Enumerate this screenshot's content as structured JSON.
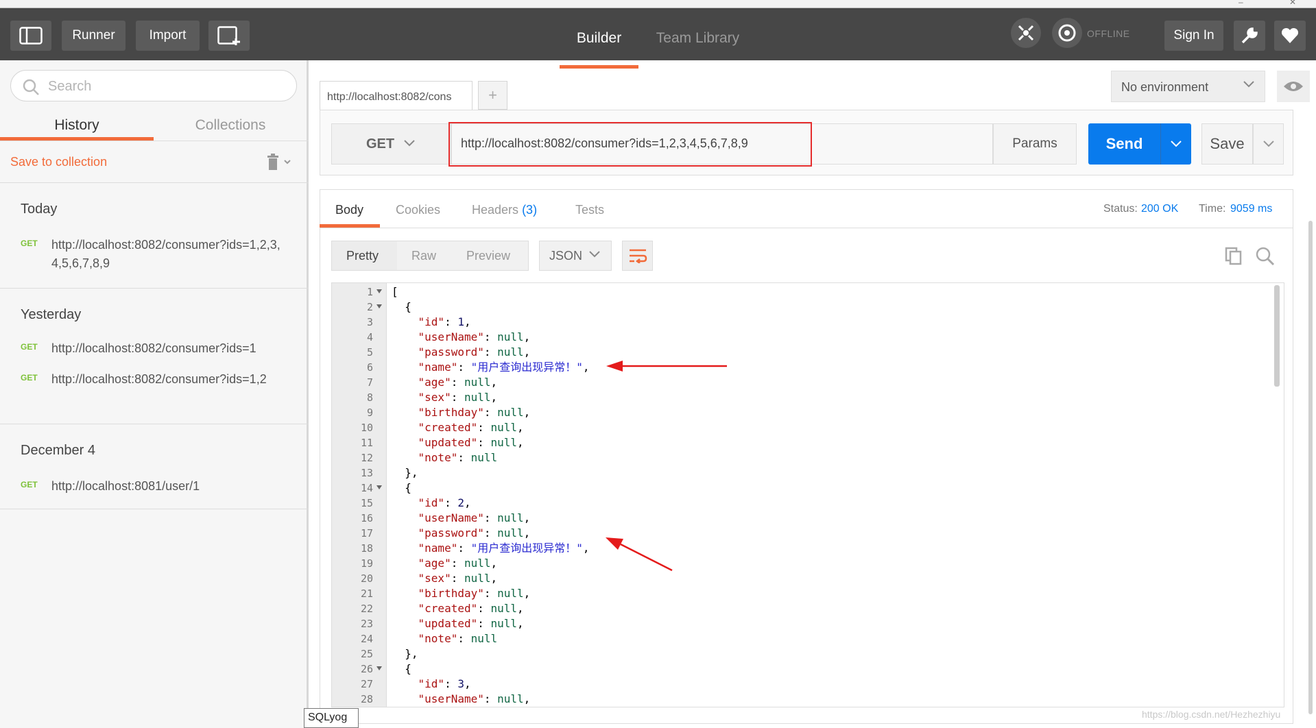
{
  "titlebar": {
    "minimize": "–",
    "close": "✕"
  },
  "header": {
    "runner": "Runner",
    "import": "Import",
    "builder": "Builder",
    "team_library": "Team Library",
    "offline": "OFFLINE",
    "sign_in": "Sign In",
    "accent": "#f26b3a"
  },
  "sidebar": {
    "search_placeholder": "Search",
    "tab_history": "History",
    "tab_collections": "Collections",
    "save_to_collection": "Save to collection",
    "groups": [
      {
        "title": "Today",
        "items": [
          {
            "method": "GET",
            "url": "http://localhost:8082/consumer?ids=1,2,3,4,5,6,7,8,9"
          }
        ]
      },
      {
        "title": "Yesterday",
        "items": [
          {
            "method": "GET",
            "url": "http://localhost:8082/consumer?ids=1"
          },
          {
            "method": "GET",
            "url": "http://localhost:8082/consumer?ids=1,2"
          }
        ]
      },
      {
        "title": "December 4",
        "items": [
          {
            "method": "GET",
            "url": "http://localhost:8081/user/1"
          }
        ]
      }
    ]
  },
  "request": {
    "tab_label": "http://localhost:8082/cons",
    "add_tab": "+",
    "environment": "No environment",
    "method": "GET",
    "url": "http://localhost:8082/consumer?ids=1,2,3,4,5,6,7,8,9",
    "params": "Params",
    "send": "Send",
    "save": "Save",
    "send_color": "#097bed"
  },
  "response": {
    "tabs": {
      "body": "Body",
      "cookies": "Cookies",
      "headers": "Headers",
      "headers_count": "(3)",
      "tests": "Tests"
    },
    "status_label": "Status:",
    "status_value": "200 OK",
    "time_label": "Time:",
    "time_value": "9059 ms",
    "formats": {
      "pretty": "Pretty",
      "raw": "Raw",
      "preview": "Preview"
    },
    "language": "JSON",
    "code_lines": [
      {
        "n": 1,
        "fold": true,
        "t": "["
      },
      {
        "n": 2,
        "fold": true,
        "t": "  {"
      },
      {
        "n": 3,
        "fold": false,
        "t": "    \"id\": 1,"
      },
      {
        "n": 4,
        "fold": false,
        "t": "    \"userName\": null,"
      },
      {
        "n": 5,
        "fold": false,
        "t": "    \"password\": null,"
      },
      {
        "n": 6,
        "fold": false,
        "t": "    \"name\": \"用户查询出现异常！\","
      },
      {
        "n": 7,
        "fold": false,
        "t": "    \"age\": null,"
      },
      {
        "n": 8,
        "fold": false,
        "t": "    \"sex\": null,"
      },
      {
        "n": 9,
        "fold": false,
        "t": "    \"birthday\": null,"
      },
      {
        "n": 10,
        "fold": false,
        "t": "    \"created\": null,"
      },
      {
        "n": 11,
        "fold": false,
        "t": "    \"updated\": null,"
      },
      {
        "n": 12,
        "fold": false,
        "t": "    \"note\": null"
      },
      {
        "n": 13,
        "fold": false,
        "t": "  },"
      },
      {
        "n": 14,
        "fold": true,
        "t": "  {"
      },
      {
        "n": 15,
        "fold": false,
        "t": "    \"id\": 2,"
      },
      {
        "n": 16,
        "fold": false,
        "t": "    \"userName\": null,"
      },
      {
        "n": 17,
        "fold": false,
        "t": "    \"password\": null,"
      },
      {
        "n": 18,
        "fold": false,
        "t": "    \"name\": \"用户查询出现异常！\","
      },
      {
        "n": 19,
        "fold": false,
        "t": "    \"age\": null,"
      },
      {
        "n": 20,
        "fold": false,
        "t": "    \"sex\": null,"
      },
      {
        "n": 21,
        "fold": false,
        "t": "    \"birthday\": null,"
      },
      {
        "n": 22,
        "fold": false,
        "t": "    \"created\": null,"
      },
      {
        "n": 23,
        "fold": false,
        "t": "    \"updated\": null,"
      },
      {
        "n": 24,
        "fold": false,
        "t": "    \"note\": null"
      },
      {
        "n": 25,
        "fold": false,
        "t": "  },"
      },
      {
        "n": 26,
        "fold": true,
        "t": "  {"
      },
      {
        "n": 27,
        "fold": false,
        "t": "    \"id\": 3,"
      },
      {
        "n": 28,
        "fold": false,
        "t": "    \"userName\": null,"
      }
    ]
  },
  "taskbar_tooltip": "SQLyog",
  "watermark": "https://blog.csdn.net/Hezhezhiyu"
}
